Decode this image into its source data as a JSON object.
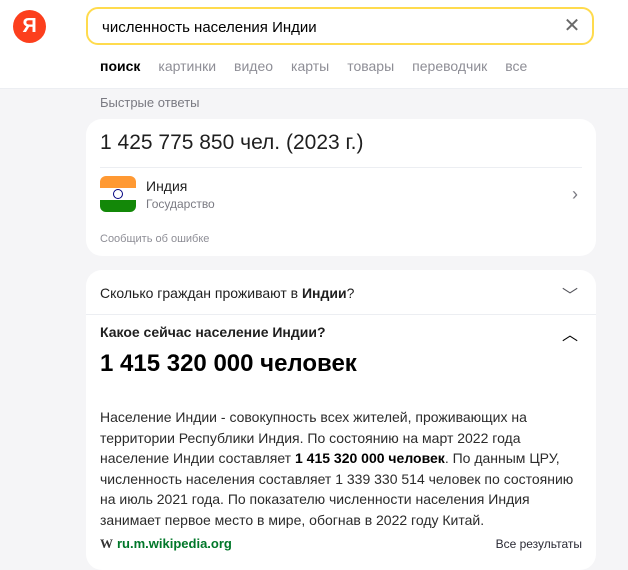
{
  "header": {
    "logo_letter": "Я",
    "search_value": "численность населения Индии",
    "clear_glyph": "✕",
    "tabs": [
      "поиск",
      "картинки",
      "видео",
      "карты",
      "товары",
      "переводчик",
      "все"
    ]
  },
  "quick_answers": {
    "label": "Быстрые ответы",
    "fact": "1 425 775 850 чел. (2023 г.)",
    "entity": {
      "name": "Индия",
      "type": "Государство",
      "icon": "india-flag-icon"
    },
    "report": "Сообщить об ошибке"
  },
  "faq": {
    "q1": {
      "prefix": "Сколько граждан проживают в ",
      "bold": "Индии",
      "suffix": "?"
    },
    "q2": "Какое сейчас население Индии?",
    "answer_big": "1 415 320 000 человек",
    "answer": {
      "p1": "Население Индии - совокупность всех жителей, проживающих на территории Республики Индия. По состоянию на март 2022 года население Индии составляет ",
      "b1": "1 415 320 000 человек",
      "p2": ". По данным ЦРУ, численность населения составляет 1 339 330 514 человек по состоянию на июль 2021 года. По показателю численности населения Индия занимает первое место в мире, обогнав в 2022 году Китай."
    },
    "source_icon": "W",
    "source_link": "ru.m.wikipedia.org",
    "all_results": "Все результаты"
  },
  "colors": {
    "brand": "#fc3f1d",
    "search_border": "#ffdb4d",
    "link": "#007729"
  }
}
